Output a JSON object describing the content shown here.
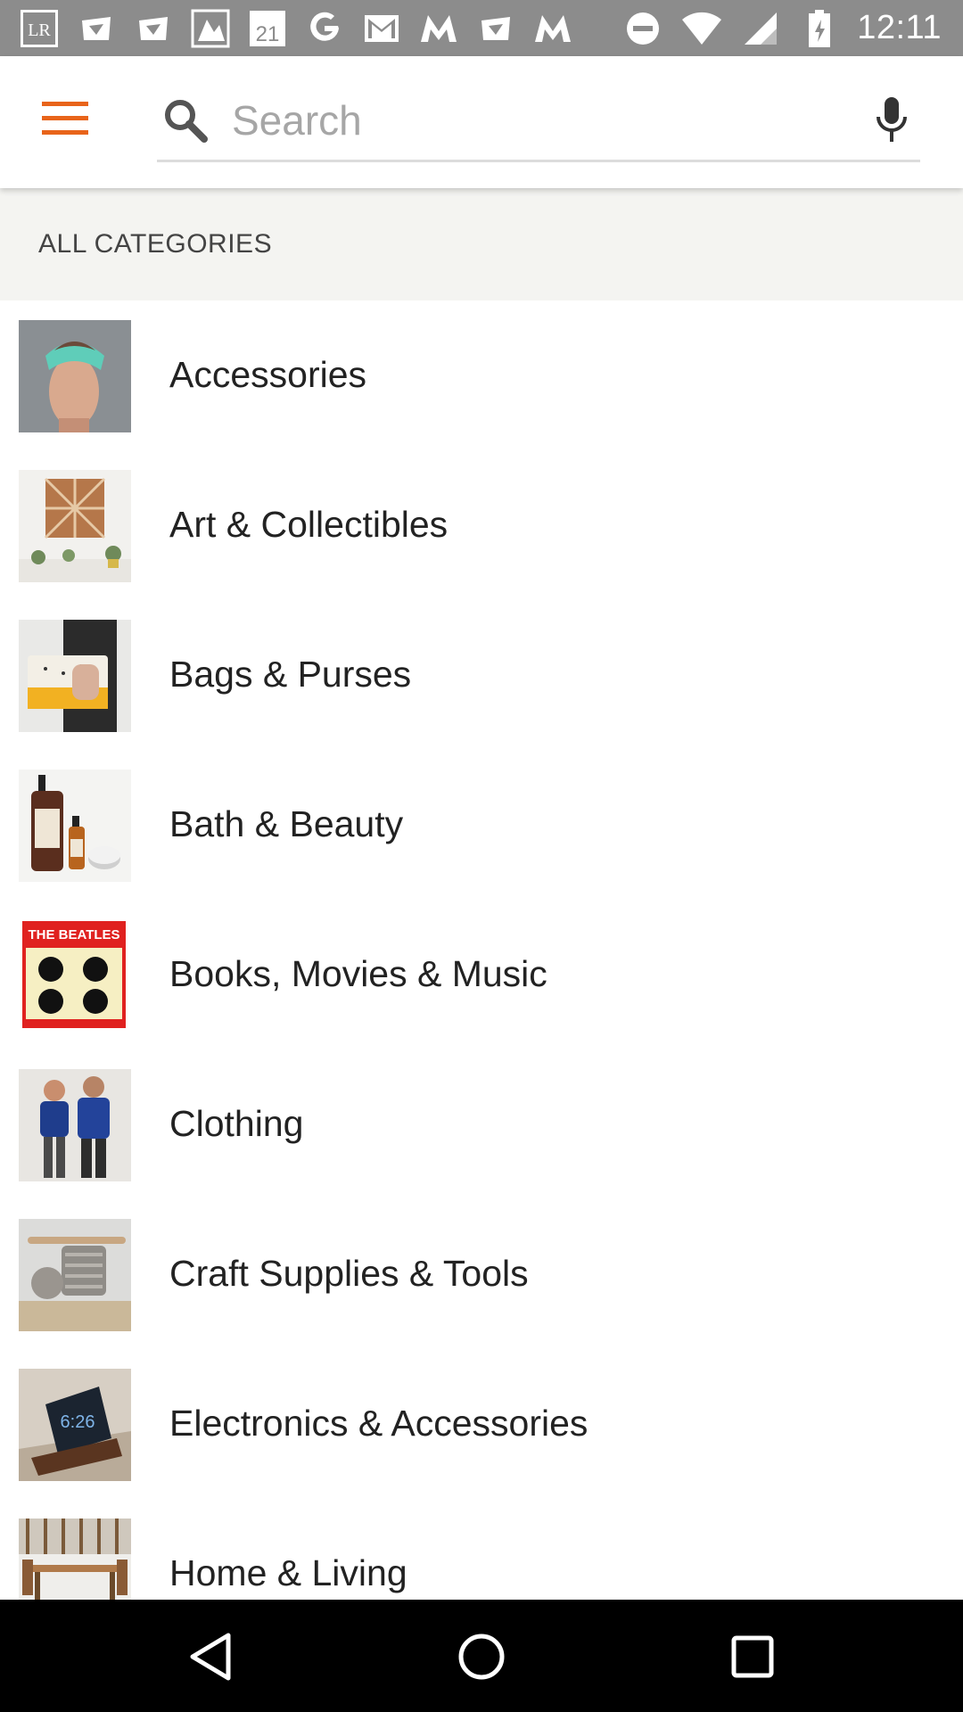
{
  "status_bar": {
    "time": "12:11",
    "notification_icons": [
      "lightroom-icon",
      "app-icon",
      "app-icon",
      "image-icon",
      "forever21-icon",
      "google-icon",
      "gmail-icon",
      "app-m-icon",
      "app-icon",
      "app-m-icon"
    ],
    "status_icons": [
      "do-not-disturb-icon",
      "wifi-icon",
      "cell-signal-icon",
      "battery-icon"
    ]
  },
  "app_bar": {
    "search": {
      "placeholder": "Search",
      "value": ""
    },
    "colors": {
      "accent": "#e8641a"
    }
  },
  "section": {
    "title": "ALL CATEGORIES"
  },
  "categories": [
    {
      "label": "Accessories"
    },
    {
      "label": "Art & Collectibles"
    },
    {
      "label": "Bags & Purses"
    },
    {
      "label": "Bath & Beauty"
    },
    {
      "label": "Books, Movies & Music"
    },
    {
      "label": "Clothing"
    },
    {
      "label": "Craft Supplies & Tools"
    },
    {
      "label": "Electronics & Accessories"
    },
    {
      "label": "Home & Living"
    }
  ],
  "nav_bar": {
    "buttons": [
      "back-icon",
      "home-icon",
      "recents-icon"
    ]
  }
}
